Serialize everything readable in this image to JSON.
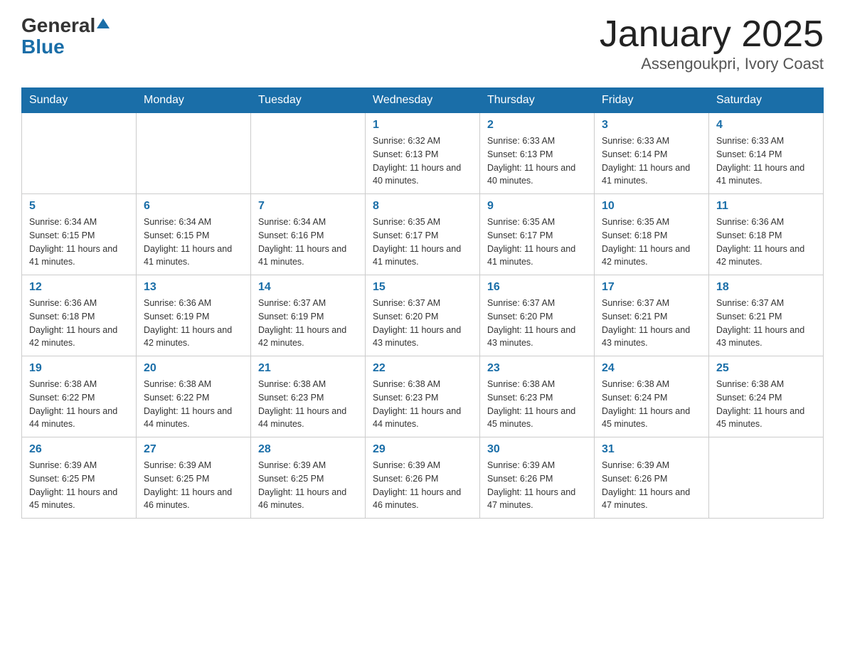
{
  "logo": {
    "general": "General",
    "triangle": "▶",
    "blue": "Blue"
  },
  "title": {
    "month_year": "January 2025",
    "location": "Assengoukpri, Ivory Coast"
  },
  "days_of_week": [
    "Sunday",
    "Monday",
    "Tuesday",
    "Wednesday",
    "Thursday",
    "Friday",
    "Saturday"
  ],
  "weeks": [
    [
      {
        "day": "",
        "info": ""
      },
      {
        "day": "",
        "info": ""
      },
      {
        "day": "",
        "info": ""
      },
      {
        "day": "1",
        "info": "Sunrise: 6:32 AM\nSunset: 6:13 PM\nDaylight: 11 hours and 40 minutes."
      },
      {
        "day": "2",
        "info": "Sunrise: 6:33 AM\nSunset: 6:13 PM\nDaylight: 11 hours and 40 minutes."
      },
      {
        "day": "3",
        "info": "Sunrise: 6:33 AM\nSunset: 6:14 PM\nDaylight: 11 hours and 41 minutes."
      },
      {
        "day": "4",
        "info": "Sunrise: 6:33 AM\nSunset: 6:14 PM\nDaylight: 11 hours and 41 minutes."
      }
    ],
    [
      {
        "day": "5",
        "info": "Sunrise: 6:34 AM\nSunset: 6:15 PM\nDaylight: 11 hours and 41 minutes."
      },
      {
        "day": "6",
        "info": "Sunrise: 6:34 AM\nSunset: 6:15 PM\nDaylight: 11 hours and 41 minutes."
      },
      {
        "day": "7",
        "info": "Sunrise: 6:34 AM\nSunset: 6:16 PM\nDaylight: 11 hours and 41 minutes."
      },
      {
        "day": "8",
        "info": "Sunrise: 6:35 AM\nSunset: 6:17 PM\nDaylight: 11 hours and 41 minutes."
      },
      {
        "day": "9",
        "info": "Sunrise: 6:35 AM\nSunset: 6:17 PM\nDaylight: 11 hours and 41 minutes."
      },
      {
        "day": "10",
        "info": "Sunrise: 6:35 AM\nSunset: 6:18 PM\nDaylight: 11 hours and 42 minutes."
      },
      {
        "day": "11",
        "info": "Sunrise: 6:36 AM\nSunset: 6:18 PM\nDaylight: 11 hours and 42 minutes."
      }
    ],
    [
      {
        "day": "12",
        "info": "Sunrise: 6:36 AM\nSunset: 6:18 PM\nDaylight: 11 hours and 42 minutes."
      },
      {
        "day": "13",
        "info": "Sunrise: 6:36 AM\nSunset: 6:19 PM\nDaylight: 11 hours and 42 minutes."
      },
      {
        "day": "14",
        "info": "Sunrise: 6:37 AM\nSunset: 6:19 PM\nDaylight: 11 hours and 42 minutes."
      },
      {
        "day": "15",
        "info": "Sunrise: 6:37 AM\nSunset: 6:20 PM\nDaylight: 11 hours and 43 minutes."
      },
      {
        "day": "16",
        "info": "Sunrise: 6:37 AM\nSunset: 6:20 PM\nDaylight: 11 hours and 43 minutes."
      },
      {
        "day": "17",
        "info": "Sunrise: 6:37 AM\nSunset: 6:21 PM\nDaylight: 11 hours and 43 minutes."
      },
      {
        "day": "18",
        "info": "Sunrise: 6:37 AM\nSunset: 6:21 PM\nDaylight: 11 hours and 43 minutes."
      }
    ],
    [
      {
        "day": "19",
        "info": "Sunrise: 6:38 AM\nSunset: 6:22 PM\nDaylight: 11 hours and 44 minutes."
      },
      {
        "day": "20",
        "info": "Sunrise: 6:38 AM\nSunset: 6:22 PM\nDaylight: 11 hours and 44 minutes."
      },
      {
        "day": "21",
        "info": "Sunrise: 6:38 AM\nSunset: 6:23 PM\nDaylight: 11 hours and 44 minutes."
      },
      {
        "day": "22",
        "info": "Sunrise: 6:38 AM\nSunset: 6:23 PM\nDaylight: 11 hours and 44 minutes."
      },
      {
        "day": "23",
        "info": "Sunrise: 6:38 AM\nSunset: 6:23 PM\nDaylight: 11 hours and 45 minutes."
      },
      {
        "day": "24",
        "info": "Sunrise: 6:38 AM\nSunset: 6:24 PM\nDaylight: 11 hours and 45 minutes."
      },
      {
        "day": "25",
        "info": "Sunrise: 6:38 AM\nSunset: 6:24 PM\nDaylight: 11 hours and 45 minutes."
      }
    ],
    [
      {
        "day": "26",
        "info": "Sunrise: 6:39 AM\nSunset: 6:25 PM\nDaylight: 11 hours and 45 minutes."
      },
      {
        "day": "27",
        "info": "Sunrise: 6:39 AM\nSunset: 6:25 PM\nDaylight: 11 hours and 46 minutes."
      },
      {
        "day": "28",
        "info": "Sunrise: 6:39 AM\nSunset: 6:25 PM\nDaylight: 11 hours and 46 minutes."
      },
      {
        "day": "29",
        "info": "Sunrise: 6:39 AM\nSunset: 6:26 PM\nDaylight: 11 hours and 46 minutes."
      },
      {
        "day": "30",
        "info": "Sunrise: 6:39 AM\nSunset: 6:26 PM\nDaylight: 11 hours and 47 minutes."
      },
      {
        "day": "31",
        "info": "Sunrise: 6:39 AM\nSunset: 6:26 PM\nDaylight: 11 hours and 47 minutes."
      },
      {
        "day": "",
        "info": ""
      }
    ]
  ]
}
